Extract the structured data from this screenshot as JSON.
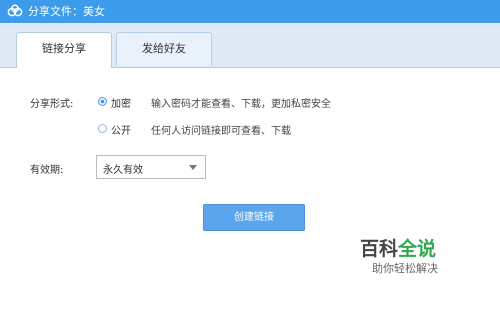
{
  "window": {
    "title": "分享文件：美女",
    "logo_icon": "baidu-cloud-logo",
    "titlebar_color": "#3c9bea"
  },
  "tabs": [
    {
      "label": "链接分享",
      "active": true
    },
    {
      "label": "发给好友",
      "active": false
    }
  ],
  "share": {
    "form_label": "分享形式:",
    "options": [
      {
        "label": "加密",
        "desc": "输入密码才能查看、下载，更加私密安全",
        "selected": true
      },
      {
        "label": "公开",
        "desc": "任何人访问链接即可查看、下载",
        "selected": false
      }
    ]
  },
  "validity": {
    "label": "有效期:",
    "selected": "永久有效"
  },
  "create_button": "创建链接",
  "accent_color": "#5aa5eb",
  "watermark": {
    "title_part1": "百科",
    "title_part2": "全说",
    "subtitle": "助你轻松解决"
  }
}
